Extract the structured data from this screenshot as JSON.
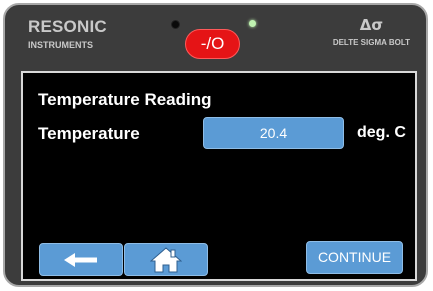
{
  "header": {
    "brand_name": "RESONIC",
    "brand_sub": "INSTRUMENTS",
    "model_symbol": "Δσ",
    "model_name": "DELTE SIGMA BOLT",
    "power_label": "-/O"
  },
  "indicators": {
    "left_led": "off",
    "right_led": "on",
    "right_led_color": "#bff2b0"
  },
  "screen": {
    "title": "Temperature Reading",
    "field_label": "Temperature",
    "field_value": "20.4",
    "unit": "deg. C"
  },
  "buttons": {
    "back_icon": "arrow-left-icon",
    "home_icon": "home-icon",
    "continue_label": "CONTINUE"
  },
  "colors": {
    "button_blue": "#5b9bd5",
    "power_red": "#e51416",
    "bezel": "#3c3c3c"
  }
}
